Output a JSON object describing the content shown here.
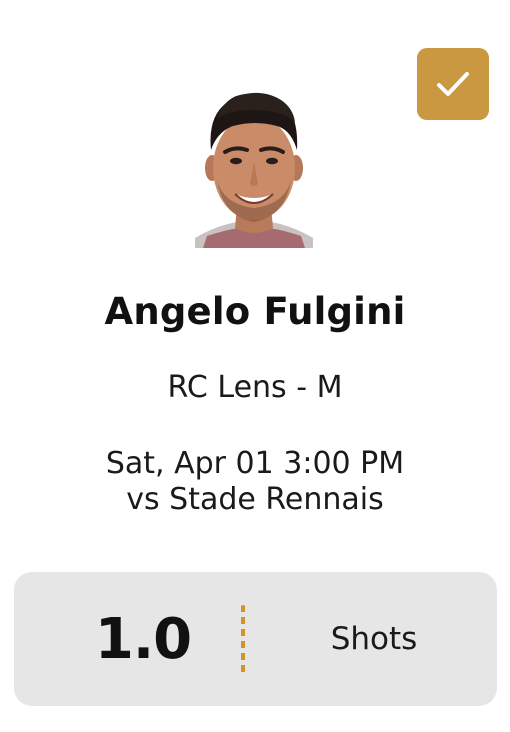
{
  "pick": {
    "selected": true,
    "icon": "check-icon",
    "accent_color": "#c99840"
  },
  "player": {
    "name": "Angelo Fulgini",
    "team_position": "RC Lens - M",
    "match_time": "Sat, Apr 01 3:00 PM",
    "opponent": "vs Stade Rennais"
  },
  "stat": {
    "value": "1.0",
    "label": "Shots",
    "divider_color": "#d4922a"
  }
}
